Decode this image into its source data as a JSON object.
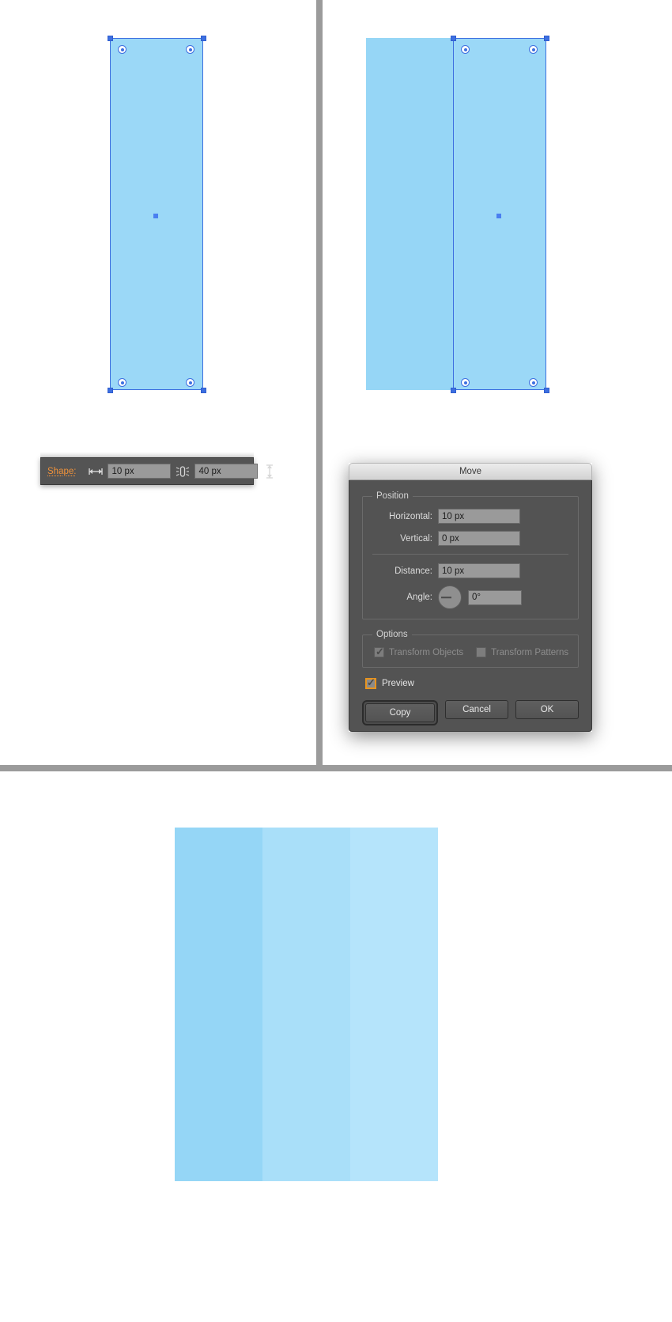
{
  "app": {
    "name": "Adobe Illustrator",
    "document_background": "#ffffff",
    "divider_color": "#9b9b9b"
  },
  "shape_toolbar": {
    "label": "Shape:",
    "width_icon": "width-arrows-icon",
    "width_value": "10 px",
    "link_icon": "constrain-proportions-icon",
    "height_value": "40 px",
    "height_icon": "height-arrows-icon",
    "background": "#545454",
    "label_color": "#f0923a"
  },
  "move_dialog": {
    "title": "Move",
    "position_group": {
      "legend": "Position",
      "horizontal_label": "Horizontal:",
      "horizontal_value": "10 px",
      "vertical_label": "Vertical:",
      "vertical_value": "0 px",
      "distance_label": "Distance:",
      "distance_value": "10 px",
      "angle_label": "Angle:",
      "angle_value": "0°",
      "angle_dial_icon": "angle-dial-icon"
    },
    "options_group": {
      "legend": "Options",
      "transform_objects_label": "Transform Objects",
      "transform_objects_checked": true,
      "transform_objects_enabled": false,
      "transform_patterns_label": "Transform Patterns",
      "transform_patterns_checked": false,
      "transform_patterns_enabled": false
    },
    "preview_label": "Preview",
    "preview_checked": true,
    "preview_focus_color": "#e8941f",
    "buttons": {
      "copy": "Copy",
      "cancel": "Cancel",
      "ok": "OK",
      "default_button": "Copy"
    },
    "body_color": "#535353",
    "titlebar_color": "#e0e0e0"
  },
  "canvas": {
    "left_panel": {
      "shape_fill": "#9bd8f7",
      "selection_color": "#3d6fe0",
      "anchors": 4,
      "corner_widgets": 4,
      "center_point": true
    },
    "right_panel": {
      "base_shape_fill": "#96d6f6",
      "copy_shape_fill": "#9bd8f7",
      "selection_color": "#3d6fe0",
      "anchors": 4,
      "corner_widgets": 4,
      "center_point": true
    },
    "result_bands": [
      {
        "name": "band-one-overlap-darkest",
        "fill": "#95d6f6"
      },
      {
        "name": "band-two-overlap-mid",
        "fill": "#a9dff9"
      },
      {
        "name": "band-three-lightest",
        "fill": "#b5e4fb"
      }
    ]
  }
}
